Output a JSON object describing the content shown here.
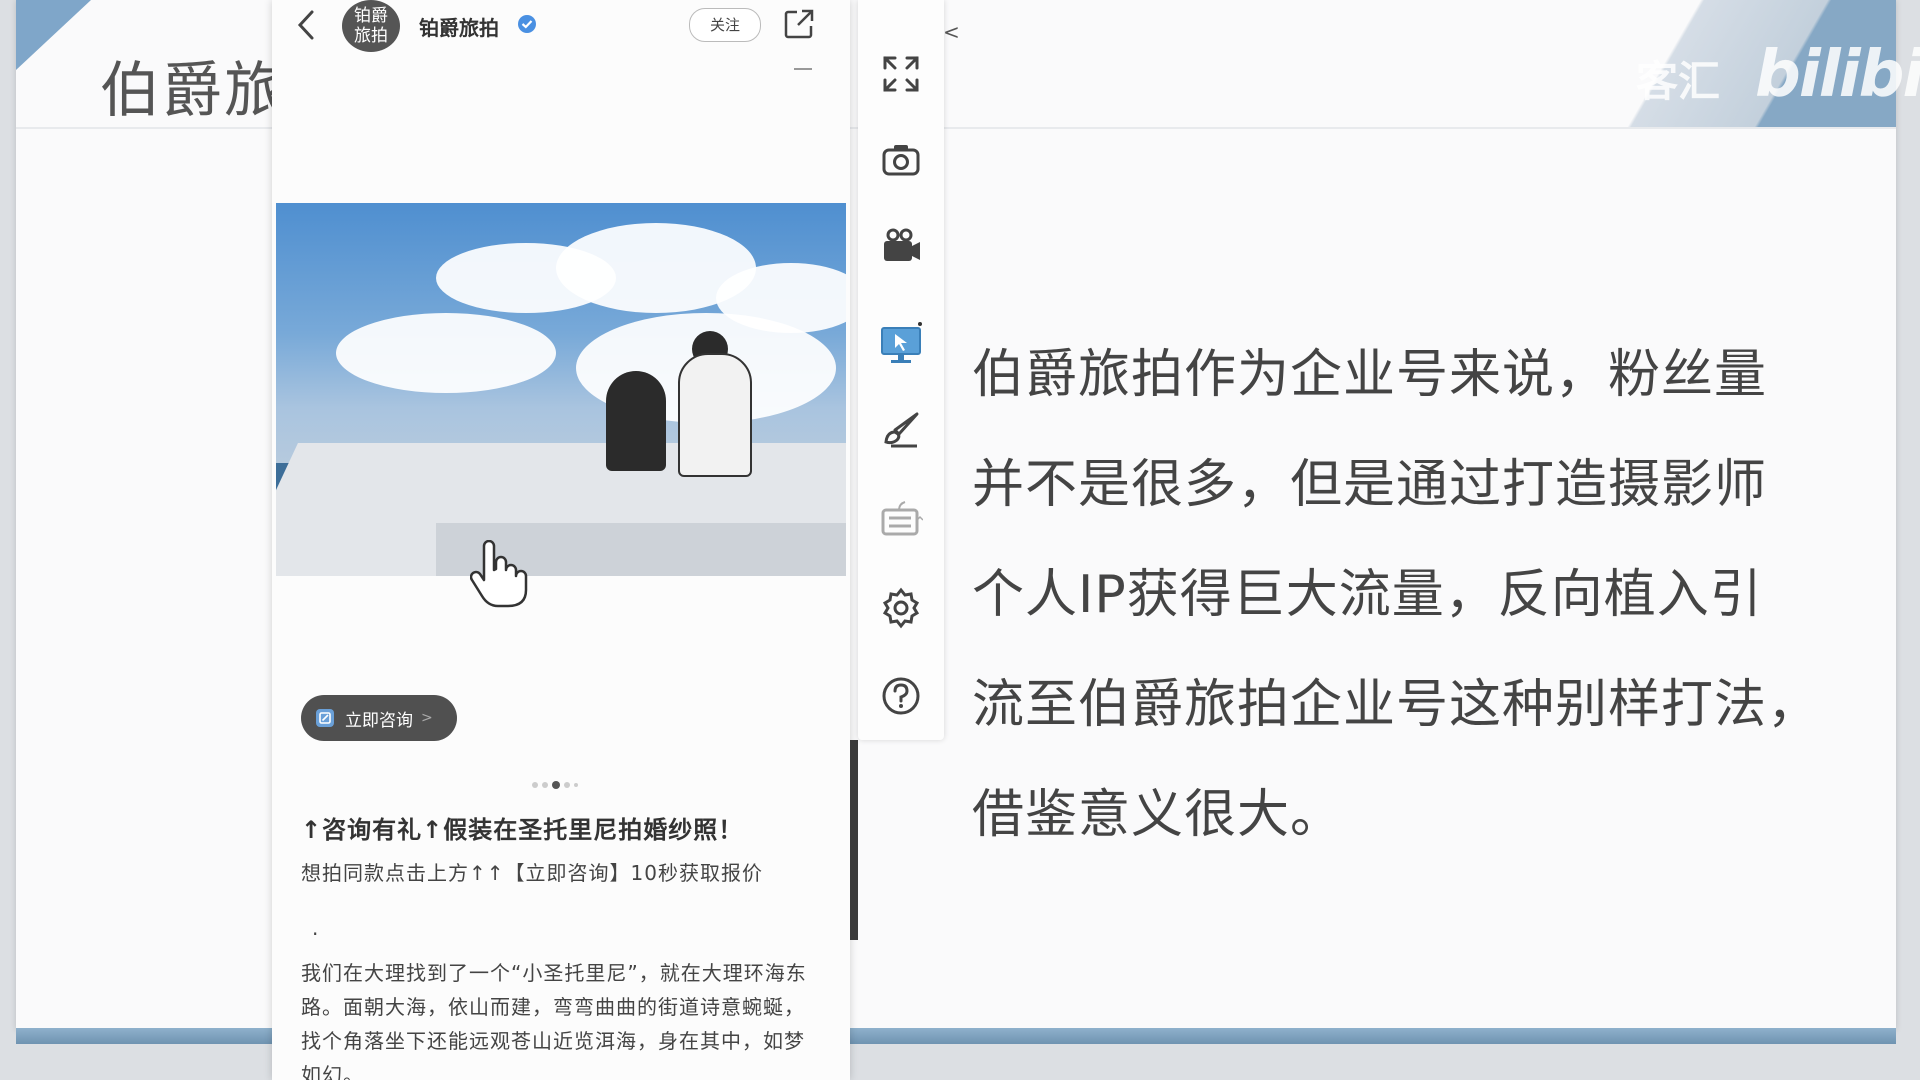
{
  "slide": {
    "title": "伯爵旅",
    "watermark_text": "客汇",
    "watermark_logo": "bilibili",
    "body_lines": [
      "伯爵旅拍作为企业号来说，粉丝量",
      "并不是很多，但是通过打造摄影师",
      "个人IP获得巨大流量，反向植入引",
      "流至伯爵旅拍企业号这种别样打法，",
      "借鉴意义很大。"
    ]
  },
  "phone": {
    "avatar_text": "铂爵旅拍",
    "account_name": "铂爵旅拍",
    "follow_label": "关注",
    "consult_label": "立即咨询",
    "consult_chevron": ">",
    "post_title": "↑咨询有礼↑假装在圣托里尼拍婚纱照！",
    "post_sub": "想拍同款点击上方↑↑【立即咨询】10秒获取报价",
    "post_dot": "·",
    "post_body": "我们在大理找到了一个“小圣托里尼”，就在大理环海东路。面朝大海，依山而建，弯弯曲曲的街道诗意蜿蜒，找个角落坐下还能远观苍山近览洱海，身在其中，如梦如幻。"
  },
  "toolbar": {
    "collapse_label": "<",
    "icons": [
      "fullscreen-icon",
      "camera-icon",
      "video-camera-icon",
      "screen-cast-icon",
      "brush-icon",
      "keyboard-icon",
      "settings-icon",
      "help-icon"
    ]
  },
  "colors": {
    "accent": "#7fa6c9",
    "text": "#444444",
    "verified": "#4a90e2"
  }
}
